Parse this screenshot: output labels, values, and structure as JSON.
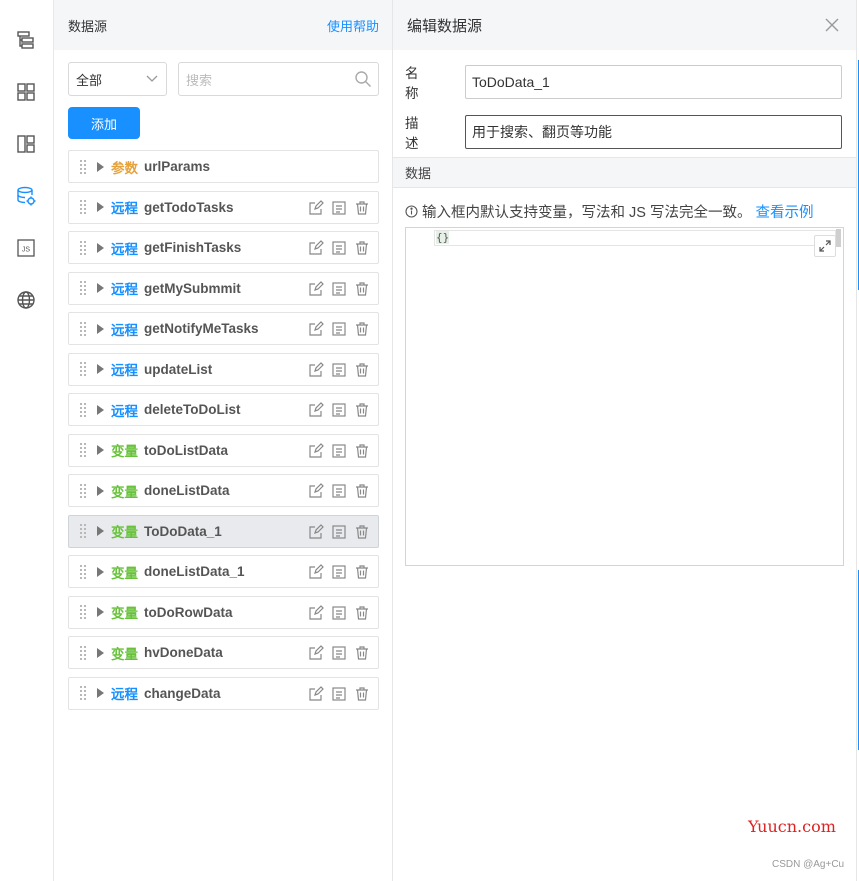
{
  "rail": {
    "icons": [
      "outline-tree-icon",
      "components-grid-icon",
      "layout-icon",
      "data-source-icon",
      "js-code-icon",
      "globe-icon"
    ]
  },
  "datasource": {
    "title": "数据源",
    "help": "使用帮助",
    "filter": {
      "value": "全部"
    },
    "search": {
      "placeholder": "搜索"
    },
    "add_label": "添加",
    "items": [
      {
        "tag": "参数",
        "kind": "param",
        "name": "urlParams",
        "actions": false
      },
      {
        "tag": "远程",
        "kind": "remote",
        "name": "getTodoTasks",
        "actions": true
      },
      {
        "tag": "远程",
        "kind": "remote",
        "name": "getFinishTasks",
        "actions": true
      },
      {
        "tag": "远程",
        "kind": "remote",
        "name": "getMySubmmit",
        "actions": true
      },
      {
        "tag": "远程",
        "kind": "remote",
        "name": "getNotifyMeTasks",
        "actions": true
      },
      {
        "tag": "远程",
        "kind": "remote",
        "name": "updateList",
        "actions": true
      },
      {
        "tag": "远程",
        "kind": "remote",
        "name": "deleteToDoList",
        "actions": true
      },
      {
        "tag": "变量",
        "kind": "var",
        "name": "toDoListData",
        "actions": true
      },
      {
        "tag": "变量",
        "kind": "var",
        "name": "doneListData",
        "actions": true
      },
      {
        "tag": "变量",
        "kind": "var",
        "name": "ToDoData_1",
        "actions": true,
        "active": true
      },
      {
        "tag": "变量",
        "kind": "var",
        "name": "doneListData_1",
        "actions": true
      },
      {
        "tag": "变量",
        "kind": "var",
        "name": "toDoRowData",
        "actions": true
      },
      {
        "tag": "变量",
        "kind": "var",
        "name": "hvDoneData",
        "actions": true
      },
      {
        "tag": "远程",
        "kind": "remote",
        "name": "changeData",
        "actions": true
      }
    ]
  },
  "editor": {
    "title": "编辑数据源",
    "name_label": "名称",
    "name_value": "ToDoData_1",
    "desc_label": "描述",
    "desc_value": "用于搜索、翻页等功能",
    "section_label": "数据",
    "hint_text": "输入框内默认支持变量，写法和 JS 写法完全一致。",
    "hint_link": "查看示例",
    "code": "{}"
  },
  "watermark": "Yuucn.com",
  "credit": "CSDN @Ag+Cu",
  "colors": {
    "accent": "#1890ff",
    "param": "#e6a23c",
    "remote": "#1890ff",
    "var": "#67c23a"
  }
}
